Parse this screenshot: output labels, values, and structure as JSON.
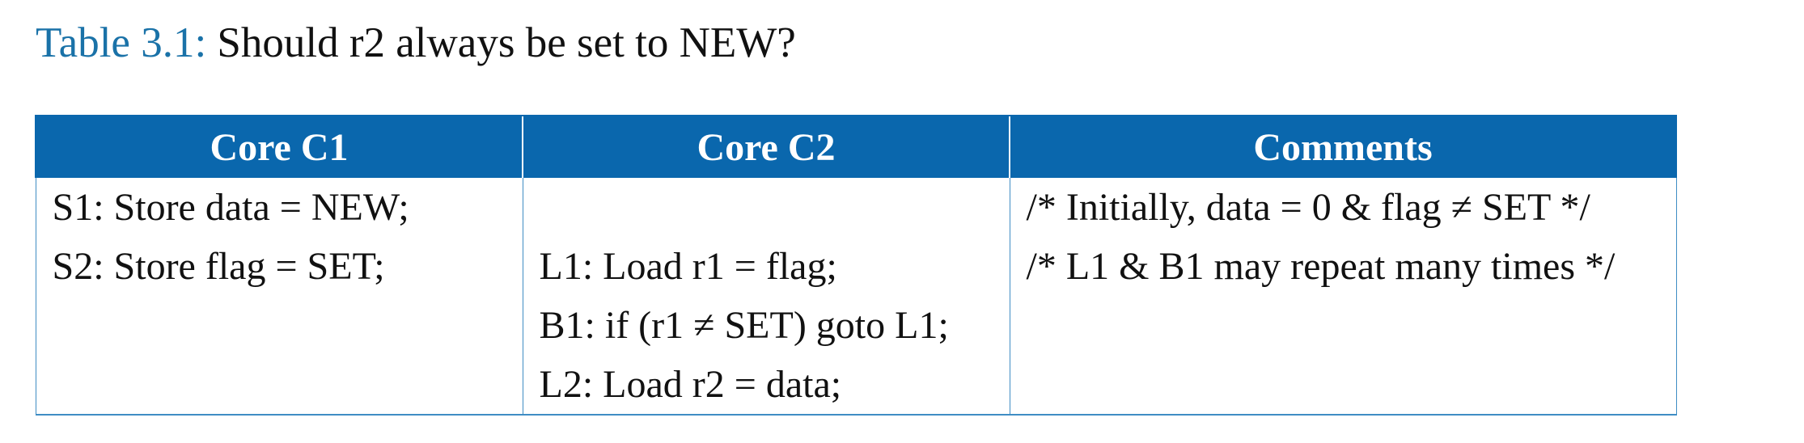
{
  "caption": {
    "label": "Table 3.1:",
    "text": "Should r2 always be set to NEW?"
  },
  "table": {
    "headers": [
      "Core C1",
      "Core C2",
      "Comments"
    ],
    "rows": [
      [
        "S1: Store data = NEW;",
        "",
        "/* Initially, data = 0 & flag ≠ SET */"
      ],
      [
        "S2: Store flag = SET;",
        "L1: Load r1 = flag;",
        "/* L1 & B1 may repeat many times */"
      ],
      [
        "",
        "B1: if (r1 ≠ SET) goto L1;",
        ""
      ],
      [
        "",
        "L2: Load r2 = data;",
        ""
      ]
    ]
  },
  "colors": {
    "caption_label": "#1a72a8",
    "header_background": "#0a67ad",
    "header_text": "#ffffff",
    "border": "#3f8dc4"
  }
}
